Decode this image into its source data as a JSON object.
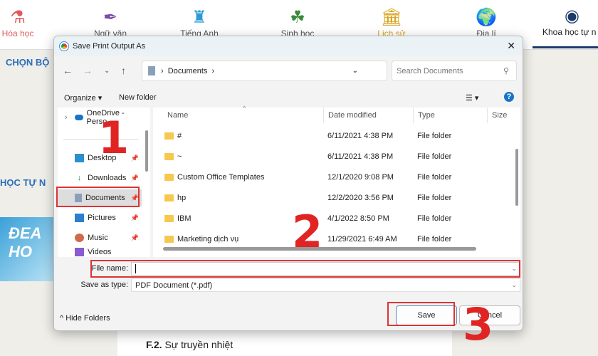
{
  "nav": [
    {
      "label": "Hóa học",
      "icon": "flask-icon",
      "color": "#e05a5a"
    },
    {
      "label": "Ngữ văn",
      "icon": "quill-icon",
      "color": "#7b4aa8"
    },
    {
      "label": "Tiếng Anh",
      "icon": "big-ben-icon",
      "color": "#2a9bd6"
    },
    {
      "label": "Sinh học",
      "icon": "leaf-icon",
      "color": "#3a8a3a"
    },
    {
      "label": "Lịch sử",
      "icon": "museum-icon",
      "color": "#d9a41e"
    },
    {
      "label": "Địa lí",
      "icon": "globe-icon",
      "color": "#4a9a3a"
    },
    {
      "label": "Khoa học tự n",
      "icon": "brain-icon",
      "color": "#1b3a6b"
    }
  ],
  "background": {
    "heading1": "CHỌN BỘ",
    "heading2": "HỌC TỰ N",
    "banner": "ĐEA HO",
    "content": "F.2.",
    "content_rest": " Sự truyền nhiệt"
  },
  "dialog": {
    "title": "Save Print Output As",
    "address": "Documents",
    "search_placeholder": "Search Documents",
    "organize": "Organize",
    "new_folder": "New folder",
    "left": [
      {
        "label": "OneDrive - Perso",
        "icon": "cloud-icon"
      },
      {
        "label": "Desktop",
        "icon": "desktop-icon"
      },
      {
        "label": "Downloads",
        "icon": "download-icon"
      },
      {
        "label": "Documents",
        "icon": "documents-icon",
        "selected": true
      },
      {
        "label": "Pictures",
        "icon": "pictures-icon"
      },
      {
        "label": "Music",
        "icon": "music-icon"
      },
      {
        "label": "Videos",
        "icon": "video-icon"
      }
    ],
    "columns": [
      "Name",
      "Date modified",
      "Type",
      "Size"
    ],
    "files": [
      {
        "name": "#",
        "date": "6/11/2021 4:38 PM",
        "type": "File folder"
      },
      {
        "name": "~",
        "date": "6/11/2021 4:38 PM",
        "type": "File folder"
      },
      {
        "name": "Custom Office Templates",
        "date": "12/1/2020 9:08 PM",
        "type": "File folder"
      },
      {
        "name": "hp",
        "date": "12/2/2020 3:56 PM",
        "type": "File folder"
      },
      {
        "name": "IBM",
        "date": "4/1/2022 8:50 PM",
        "type": "File folder"
      },
      {
        "name": "Marketing dịch vụ",
        "date": "11/29/2021 6:49 AM",
        "type": "File folder"
      }
    ],
    "file_name_label": "File name:",
    "file_name_value": "",
    "save_type_label": "Save as type:",
    "save_type_value": "PDF Document (*.pdf)",
    "hide_folders": "Hide Folders",
    "save": "Save",
    "cancel": "Cancel"
  },
  "annotations": [
    "1",
    "2",
    "3"
  ],
  "colors": {
    "annotation": "#e02424",
    "accent": "#1b3a6b"
  }
}
